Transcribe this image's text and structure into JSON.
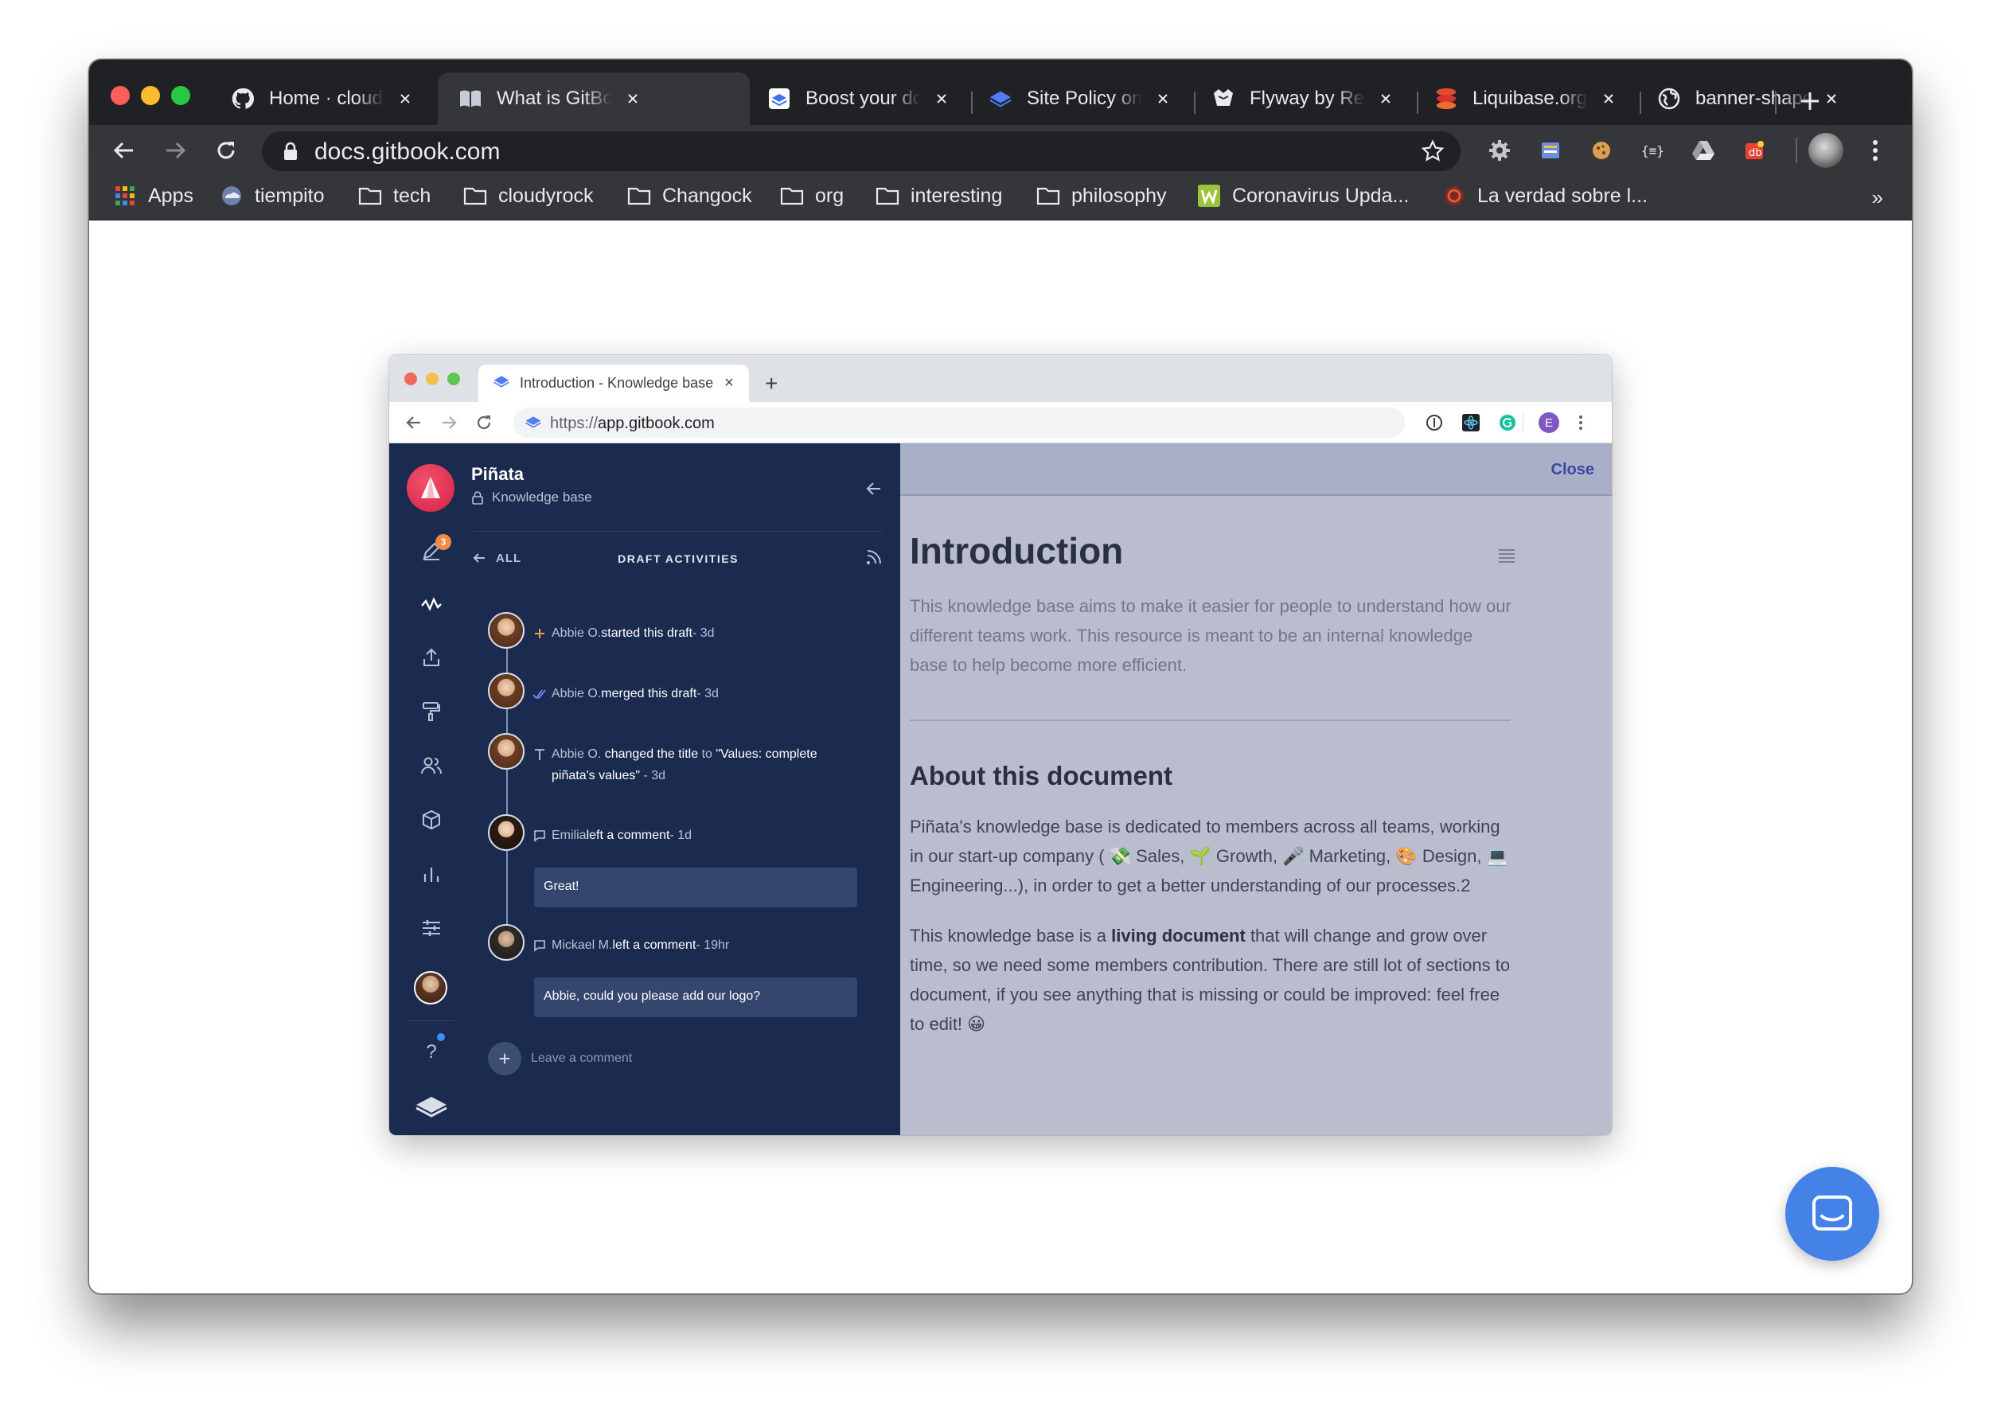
{
  "browser": {
    "tabs": [
      {
        "title": "Home · cloudyrock",
        "icon": "github-icon"
      },
      {
        "title": "What is GitBook?",
        "icon": "book-icon",
        "active": true
      },
      {
        "title": "Boost your docs",
        "icon": "doc-blue-icon"
      },
      {
        "title": "Site Policy on",
        "icon": "gitbook-icon"
      },
      {
        "title": "Flyway by Redgate",
        "icon": "flyway-bird-icon"
      },
      {
        "title": "Liquibase.org",
        "icon": "liquibase-icon"
      },
      {
        "title": "banner-shape",
        "icon": "globe-icon"
      }
    ],
    "url": "docs.gitbook.com",
    "bookmarks": [
      {
        "label": "Apps",
        "icon": "apps-grid-icon"
      },
      {
        "label": "tiempito",
        "icon": "weather-icon"
      },
      {
        "label": "tech",
        "icon": "folder-icon"
      },
      {
        "label": "cloudyrock",
        "icon": "folder-icon"
      },
      {
        "label": "Changock",
        "icon": "folder-icon"
      },
      {
        "label": "org",
        "icon": "folder-icon"
      },
      {
        "label": "interesting",
        "icon": "folder-icon"
      },
      {
        "label": "philosophy",
        "icon": "folder-icon"
      },
      {
        "label": "Coronavirus Upda...",
        "icon": "w-icon"
      },
      {
        "label": "La verdad sobre l...",
        "icon": "circle-logo-icon"
      }
    ],
    "bookmarks_more": "»"
  },
  "inner": {
    "tab_title": "Introduction - Knowledge base",
    "url_scheme": "https://",
    "url_host": "app.gitbook.com",
    "profile_letter": "E",
    "space": {
      "name": "Piñata",
      "subtitle": "Knowledge base"
    },
    "draft_badge": "3",
    "activities_header": {
      "back": "ALL",
      "title": "DRAFT ACTIVITIES"
    },
    "activities": [
      {
        "icon": "plus",
        "pre": "Abbie O.",
        "action": " started this draft",
        "time": " - 3d"
      },
      {
        "icon": "check",
        "pre": "Abbie O.",
        "action": " merged this draft",
        "time": " - 3d"
      },
      {
        "icon": "title",
        "pre": "Abbie O.",
        "action": " changed the title",
        "to": " to ",
        "value": "\"Values: complete",
        "value2": "piñata's values\"",
        "time": " - 3d"
      },
      {
        "icon": "comment",
        "pre": "Emilia",
        "action": " left a comment",
        "time": " - 1d",
        "comment": "Great!"
      },
      {
        "icon": "comment",
        "pre": "Mickael M.",
        "action": " left a comment",
        "time": " - 19hr",
        "comment": "Abbie, could you please add our logo?"
      }
    ],
    "leave_comment": "Leave a comment",
    "close": "Close",
    "doc": {
      "title": "Introduction",
      "intro": "This knowledge base aims to make it easier for people to understand how our different teams work. This resource is meant to be an internal knowledge base to help become more efficient.",
      "h2": "About this document",
      "p1": "Piñata's knowledge base is dedicated to members across all teams, working in our start-up company ( 💸 Sales, 🌱 Growth, 🎤 Marketing, 🎨 Design, 💻 Engineering...), in order to get a better understanding of our processes.2",
      "p2_a": "This knowledge base is a ",
      "p2_b": "living document",
      "p2_c": " that will change and grow over time, so we need some members contribution. There are still lot of sections to document, if you see anything that is missing or could be improved: feel free to edit! 😀"
    }
  }
}
